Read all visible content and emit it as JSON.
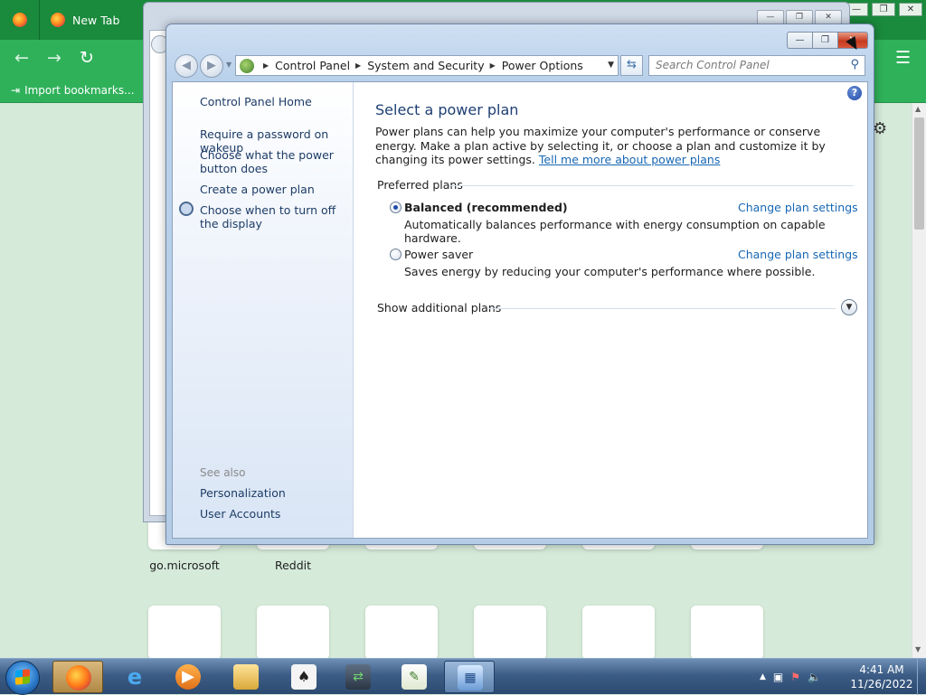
{
  "browser": {
    "tab_label": "New Tab",
    "bookmarks_import": "Import bookmarks...",
    "shortcuts": [
      {
        "label": "go.microsoft"
      },
      {
        "label": "Reddit"
      }
    ]
  },
  "window": {
    "close_glyph": "✕",
    "min_glyph": "—",
    "max_glyph": "❐"
  },
  "address": {
    "crumbs": [
      "Control Panel",
      "System and Security",
      "Power Options"
    ],
    "search_placeholder": "Search Control Panel"
  },
  "sidebar": {
    "home": "Control Panel Home",
    "links": [
      "Require a password on wakeup",
      "Choose what the power button does",
      "Create a power plan",
      "Choose when to turn off the display"
    ],
    "see_also_heading": "See also",
    "see_also": [
      "Personalization",
      "User Accounts"
    ]
  },
  "main": {
    "title": "Select a power plan",
    "description": "Power plans can help you maximize your computer's performance or conserve energy. Make a plan active by selecting it, or choose a plan and customize it by changing its power settings.",
    "tell_me_more": "Tell me more about power plans",
    "preferred_heading": "Preferred plans",
    "plans": [
      {
        "name": "Balanced (recommended)",
        "description": "Automatically balances performance with energy consumption on capable hardware.",
        "link": "Change plan settings",
        "selected": true
      },
      {
        "name": "Power saver",
        "description": "Saves energy by reducing your computer's performance where possible.",
        "link": "Change plan settings",
        "selected": false
      }
    ],
    "show_additional": "Show additional plans"
  },
  "taskbar": {
    "time": "4:41 AM",
    "date": "11/26/2022"
  },
  "colors": {
    "link": "#1767b4",
    "title": "#1e3f73",
    "firefox_green": "#1a8a3c",
    "close_red": "#c63a1e"
  }
}
